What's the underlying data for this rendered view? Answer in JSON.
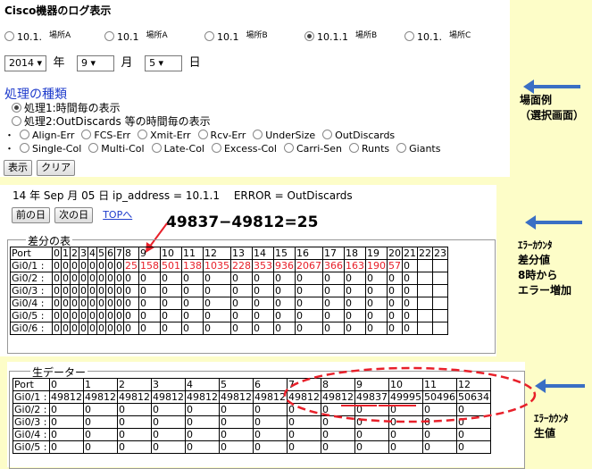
{
  "top": {
    "title": "Cisco機器のログ表示",
    "locations": [
      {
        "ip": "10.1.",
        "place": "場所A",
        "on": false
      },
      {
        "ip": "10.1",
        "place": "場所A",
        "on": false
      },
      {
        "ip": "10.1",
        "place": "場所B",
        "on": false
      },
      {
        "ip": "10.1.1",
        "place": "場所B",
        "on": true
      },
      {
        "ip": "10.1.",
        "place": "場所C",
        "on": false
      }
    ],
    "year": "2014",
    "year_unit": "年",
    "month": "9",
    "month_unit": "月",
    "day": "5",
    "day_unit": "日",
    "proc_title": "処理の種類",
    "proc1": "処理1:時間毎の表示",
    "proc2": "処理2:OutDiscards 等の時間毎の表示",
    "errors1": [
      "Align-Err",
      "FCS-Err",
      "Xmit-Err",
      "Rcv-Err",
      "UnderSize",
      "OutDiscards"
    ],
    "errors2": [
      "Single-Col",
      "Multi-Col",
      "Late-Col",
      "Excess-Col",
      "Carri-Sen",
      "Runts",
      "Giants"
    ],
    "btn_show": "表示",
    "btn_clear": "クリア"
  },
  "note1": {
    "line1": "場面例",
    "line2": "（選択画面）"
  },
  "mid": {
    "header": "14 年 Sep 月 05 日 ip_address = 10.1.1",
    "error_text": "ERROR = OutDiscards",
    "prev": "前の日",
    "next": "次の日",
    "top_link": "TOPへ",
    "formula": "49837−49812=25",
    "legend": "差分の表",
    "cols": [
      "Port",
      "0",
      "1",
      "2",
      "3",
      "4",
      "5",
      "6",
      "7",
      "8",
      "9",
      "10",
      "11",
      "12",
      "13",
      "14",
      "15",
      "16",
      "17",
      "18",
      "19",
      "20",
      "21",
      "22",
      "23"
    ],
    "rows": [
      {
        "port": "Gi0/1 :",
        "v": [
          "0",
          "0",
          "0",
          "0",
          "0",
          "0",
          "0",
          "0",
          "25",
          "158",
          "501",
          "138",
          "1035",
          "228",
          "353",
          "936",
          "2067",
          "366",
          "163",
          "190",
          "57",
          "0",
          "",
          ""
        ]
      },
      {
        "port": "Gi0/2 :",
        "v": [
          "0",
          "0",
          "0",
          "0",
          "0",
          "0",
          "0",
          "0",
          "0",
          "0",
          "0",
          "0",
          "0",
          "0",
          "0",
          "0",
          "0",
          "0",
          "0",
          "0",
          "0",
          "0",
          "",
          ""
        ]
      },
      {
        "port": "Gi0/3 :",
        "v": [
          "0",
          "0",
          "0",
          "0",
          "0",
          "0",
          "0",
          "0",
          "0",
          "0",
          "0",
          "0",
          "0",
          "0",
          "0",
          "0",
          "0",
          "0",
          "0",
          "0",
          "0",
          "0",
          "",
          ""
        ]
      },
      {
        "port": "Gi0/4 :",
        "v": [
          "0",
          "0",
          "0",
          "0",
          "0",
          "0",
          "0",
          "0",
          "0",
          "0",
          "0",
          "0",
          "0",
          "0",
          "0",
          "0",
          "0",
          "0",
          "0",
          "0",
          "0",
          "0",
          "",
          ""
        ]
      },
      {
        "port": "Gi0/5 :",
        "v": [
          "0",
          "0",
          "0",
          "0",
          "0",
          "0",
          "0",
          "0",
          "0",
          "0",
          "0",
          "0",
          "0",
          "0",
          "0",
          "0",
          "0",
          "0",
          "0",
          "0",
          "0",
          "0",
          "",
          ""
        ]
      },
      {
        "port": "Gi0/6 :",
        "v": [
          "0",
          "0",
          "0",
          "0",
          "0",
          "0",
          "0",
          "0",
          "0",
          "0",
          "0",
          "0",
          "0",
          "0",
          "0",
          "0",
          "0",
          "0",
          "0",
          "0",
          "0",
          "0",
          "",
          ""
        ]
      }
    ]
  },
  "note2": {
    "l1": "ｴﾗｰｶｳﾝﾀ",
    "l2": "差分値",
    "l3": "8時から",
    "l4": "エラー増加"
  },
  "raw": {
    "legend": "生データー",
    "cols": [
      "Port",
      "0",
      "1",
      "2",
      "3",
      "4",
      "5",
      "6",
      "7",
      "8",
      "9",
      "10",
      "11",
      "12"
    ],
    "rows": [
      {
        "port": "Gi0/1 :",
        "v": [
          "49812",
          "49812",
          "49812",
          "49812",
          "49812",
          "49812",
          "49812",
          "49812",
          "49812",
          "49837",
          "49995",
          "50496",
          "50634"
        ]
      },
      {
        "port": "Gi0/2 :",
        "v": [
          "0",
          "0",
          "0",
          "0",
          "0",
          "0",
          "0",
          "0",
          "0",
          "0",
          "0",
          "0",
          "0"
        ]
      },
      {
        "port": "Gi0/3 :",
        "v": [
          "0",
          "0",
          "0",
          "0",
          "0",
          "0",
          "0",
          "0",
          "0",
          "0",
          "0",
          "0",
          "0"
        ]
      },
      {
        "port": "Gi0/4 :",
        "v": [
          "0",
          "0",
          "0",
          "0",
          "0",
          "0",
          "0",
          "0",
          "0",
          "0",
          "0",
          "0",
          "0"
        ]
      },
      {
        "port": "Gi0/5 :",
        "v": [
          "0",
          "0",
          "0",
          "0",
          "0",
          "0",
          "0",
          "0",
          "0",
          "0",
          "0",
          "0",
          "0"
        ]
      }
    ]
  },
  "note3": {
    "l1": "ｴﾗｰｶｳﾝﾀ",
    "l2": "生値"
  }
}
